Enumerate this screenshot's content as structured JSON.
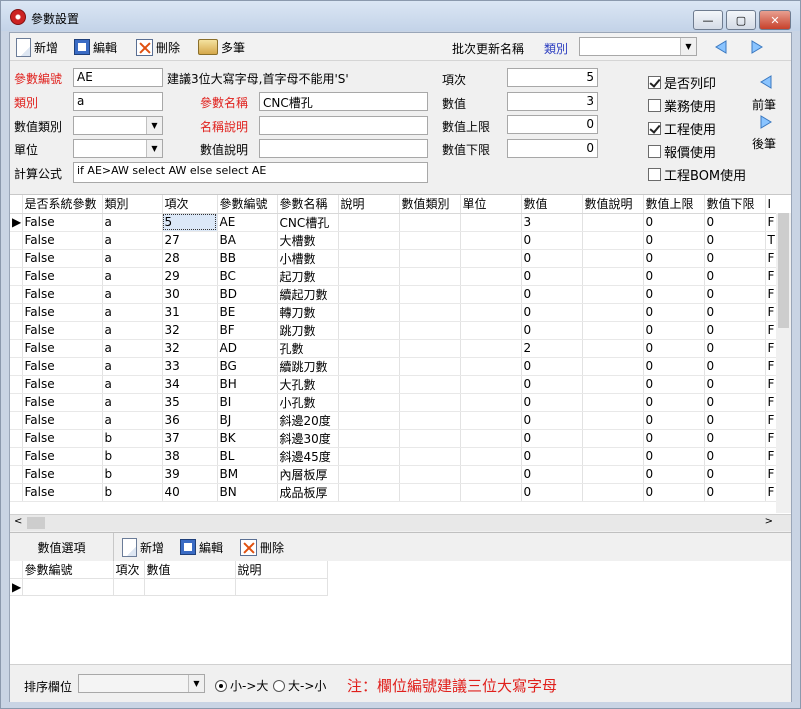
{
  "window": {
    "title": "參數設置",
    "controls": {
      "minimize": "—",
      "maximize": "▢",
      "close": "✕"
    }
  },
  "toolbar": {
    "new_label": "新增",
    "edit_label": "編輯",
    "delete_label": "刪除",
    "multi_label": "多筆",
    "batch_label": "批次更新名稱",
    "category_label": "類別",
    "category_value": ""
  },
  "form": {
    "param_code_label": "參數編號",
    "param_code_value": "AE",
    "suggestion": "建議3位大寫字母,首字母不能用'S'",
    "category_label": "類別",
    "category_value": "a",
    "param_name_label": "參數名稱",
    "param_name_value": "CNC槽孔",
    "value_type_label": "數值類別",
    "value_type_value": "",
    "name_desc_label": "名稱說明",
    "name_desc_value": "",
    "unit_label": "單位",
    "unit_value": "",
    "value_desc_label": "數值說明",
    "value_desc_value": "",
    "formula_label": "計算公式",
    "formula_value": "if AE>AW select AW else select AE",
    "item_no_label": "項次",
    "item_no_value": "5",
    "value_label": "數值",
    "value_value": "3",
    "upper_label": "數值上限",
    "upper_value": "0",
    "lower_label": "數值下限",
    "lower_value": "0"
  },
  "checkboxes": [
    {
      "label": "是否列印",
      "checked": true
    },
    {
      "label": "業務使用",
      "checked": false
    },
    {
      "label": "工程使用",
      "checked": true
    },
    {
      "label": "報價使用",
      "checked": false
    },
    {
      "label": "工程BOM使用",
      "checked": false
    }
  ],
  "nav": {
    "prev_label": "前筆",
    "next_label": "後筆"
  },
  "grid": {
    "columns": [
      "是否系統參數",
      "類別",
      "項次",
      "參數編號",
      "參數名稱",
      "說明",
      "數值類別",
      "單位",
      "數值",
      "數值說明",
      "數值上限",
      "數值下限",
      "I"
    ],
    "rows": [
      [
        "False",
        "a",
        "5",
        "AE",
        "CNC槽孔",
        "",
        "",
        "",
        "3",
        "",
        "0",
        "0",
        "F"
      ],
      [
        "False",
        "a",
        "27",
        "BA",
        "大槽數",
        "",
        "",
        "",
        "0",
        "",
        "0",
        "0",
        "T"
      ],
      [
        "False",
        "a",
        "28",
        "BB",
        "小槽數",
        "",
        "",
        "",
        "0",
        "",
        "0",
        "0",
        "F"
      ],
      [
        "False",
        "a",
        "29",
        "BC",
        "起刀數",
        "",
        "",
        "",
        "0",
        "",
        "0",
        "0",
        "F"
      ],
      [
        "False",
        "a",
        "30",
        "BD",
        "續起刀數",
        "",
        "",
        "",
        "0",
        "",
        "0",
        "0",
        "F"
      ],
      [
        "False",
        "a",
        "31",
        "BE",
        "轉刀數",
        "",
        "",
        "",
        "0",
        "",
        "0",
        "0",
        "F"
      ],
      [
        "False",
        "a",
        "32",
        "BF",
        "跳刀數",
        "",
        "",
        "",
        "0",
        "",
        "0",
        "0",
        "F"
      ],
      [
        "False",
        "a",
        "32",
        "AD",
        "孔數",
        "",
        "",
        "",
        "2",
        "",
        "0",
        "0",
        "F"
      ],
      [
        "False",
        "a",
        "33",
        "BG",
        "續跳刀數",
        "",
        "",
        "",
        "0",
        "",
        "0",
        "0",
        "F"
      ],
      [
        "False",
        "a",
        "34",
        "BH",
        "大孔數",
        "",
        "",
        "",
        "0",
        "",
        "0",
        "0",
        "F"
      ],
      [
        "False",
        "a",
        "35",
        "BI",
        "小孔數",
        "",
        "",
        "",
        "0",
        "",
        "0",
        "0",
        "F"
      ],
      [
        "False",
        "a",
        "36",
        "BJ",
        "斜邊20度",
        "",
        "",
        "",
        "0",
        "",
        "0",
        "0",
        "F"
      ],
      [
        "False",
        "b",
        "37",
        "BK",
        "斜邊30度",
        "",
        "",
        "",
        "0",
        "",
        "0",
        "0",
        "F"
      ],
      [
        "False",
        "b",
        "38",
        "BL",
        "斜邊45度",
        "",
        "",
        "",
        "0",
        "",
        "0",
        "0",
        "F"
      ],
      [
        "False",
        "b",
        "39",
        "BM",
        "內層板厚",
        "",
        "",
        "",
        "0",
        "",
        "0",
        "0",
        "F"
      ],
      [
        "False",
        "b",
        "40",
        "BN",
        "成品板厚",
        "",
        "",
        "",
        "0",
        "",
        "0",
        "0",
        "F"
      ]
    ]
  },
  "lower": {
    "tab_label": "數值選項",
    "new_label": "新增",
    "edit_label": "編輯",
    "delete_label": "刪除",
    "columns": [
      "參數編號",
      "項次",
      "數值",
      "說明"
    ]
  },
  "footer": {
    "sort_label": "排序欄位",
    "sort_value": "",
    "asc_label": "小->大",
    "desc_label": "大->小",
    "note": "注：欄位編號建議三位大寫字母"
  },
  "colors": {
    "required": "#e0201c",
    "accent": "#2a3cc0",
    "note": "#e0201c"
  }
}
